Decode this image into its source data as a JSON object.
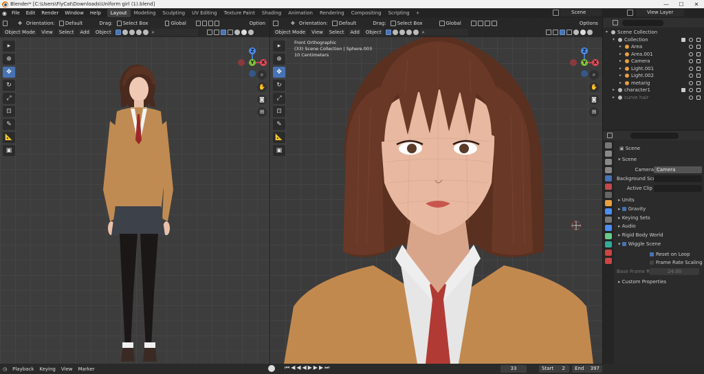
{
  "window": {
    "title": "Blender* [C:\\Users\\FlyCat\\Downloads\\Uniform girl (1).blend]",
    "min": "—",
    "max": "☐",
    "close": "✕"
  },
  "menu": [
    "File",
    "Edit",
    "Render",
    "Window",
    "Help"
  ],
  "workspaces": [
    "Layout",
    "Modeling",
    "Sculpting",
    "UV Editing",
    "Texture Paint",
    "Shading",
    "Animation",
    "Rendering",
    "Compositing",
    "Scripting"
  ],
  "workspace_add": "+",
  "scene": "Scene",
  "view_layer": "View Layer",
  "viewport_left": {
    "mode": "Object Mode",
    "menus": [
      "View",
      "Select",
      "Add",
      "Object"
    ],
    "orientation_label": "Orientation:",
    "orientation_value": "Default",
    "drag_label": "Drag:",
    "drag_value": "Select Box",
    "transform": "Global",
    "options": "Option"
  },
  "viewport_right": {
    "mode": "Object Mode",
    "menus": [
      "View",
      "Select",
      "Add",
      "Object"
    ],
    "orientation_label": "Orientation:",
    "orientation_value": "Default",
    "drag_label": "Drag:",
    "drag_value": "Select Box",
    "transform": "Global",
    "options": "Options",
    "info": [
      "Front Orthographic",
      "(33) Scene Collection | Sphere.003",
      "10 Centimeters"
    ]
  },
  "gizmo_axes": {
    "x": "X",
    "y": "Y",
    "z": "Z"
  },
  "outliner": {
    "rows": [
      {
        "label": "Scene Collection",
        "indent": 0,
        "checked": false
      },
      {
        "label": "Collection",
        "indent": 1,
        "checked": true
      },
      {
        "label": "Area",
        "indent": 2,
        "checked": false
      },
      {
        "label": "Area.001",
        "indent": 2,
        "checked": false
      },
      {
        "label": "Camera",
        "indent": 2,
        "checked": false
      },
      {
        "label": "Light.001",
        "indent": 2,
        "checked": false
      },
      {
        "label": "Light.002",
        "indent": 2,
        "checked": false
      },
      {
        "label": "metarig",
        "indent": 2,
        "checked": false
      },
      {
        "label": "character1",
        "indent": 1,
        "checked": true
      },
      {
        "label": "curve hair",
        "indent": 1,
        "checked": false
      }
    ]
  },
  "properties": {
    "context": "Scene",
    "panel": "Scene",
    "camera_label": "Camera",
    "camera_value": "Camera",
    "bg_label": "Background Sce...",
    "clip_label": "Active Clip",
    "sections": [
      "Units",
      "Gravity",
      "Keying Sets",
      "Audio",
      "Rigid Body World",
      "Wiggle Scene"
    ],
    "wiggle": {
      "reset": "Reset on Loop",
      "frame_rate": "Frame Rate Scaling",
      "base_label": "Base Frame R...",
      "base_value": "24.00"
    },
    "custom": "Custom Properties"
  },
  "timeline": {
    "menus": [
      "Playback",
      "Keying",
      "View",
      "Marker"
    ],
    "current": "33",
    "start_label": "Start",
    "start": "2",
    "end_label": "End",
    "end": "397"
  },
  "colors": {
    "accent": "#4772b3",
    "orange": "#e87d0d",
    "axis_x": "#e84856",
    "axis_y": "#7ec23a",
    "axis_z": "#4d8ef0"
  }
}
